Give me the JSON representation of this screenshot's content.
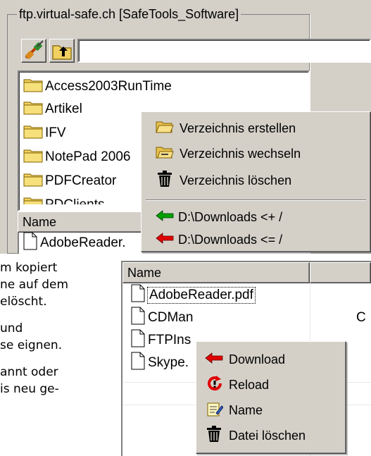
{
  "panel": {
    "title": "ftp.virtual-safe.ch [SafeTools_Software]",
    "path_value": ""
  },
  "toolbar": {
    "connect_icon": "connect-plug-icon",
    "up_icon": "folder-up-icon"
  },
  "folders": [
    {
      "label": "Access2003RunTime"
    },
    {
      "label": "Artikel"
    },
    {
      "label": "IFV"
    },
    {
      "label": "NotePad 2006"
    },
    {
      "label": "PDFCreator"
    },
    {
      "label": "PDClients"
    }
  ],
  "top_list": {
    "header_name": "Name",
    "first_file": "AdobeReader."
  },
  "folder_menu": {
    "items": [
      {
        "label": "Verzeichnis erstellen",
        "icon": "folder-open-icon"
      },
      {
        "label": "Verzeichnis wechseln",
        "icon": "folder-change-icon"
      },
      {
        "label": "Verzeichnis löschen",
        "icon": "trash-icon"
      },
      {
        "label": "D:\\Downloads <+ /",
        "icon": "arrow-left-green-icon"
      },
      {
        "label": "D:\\Downloads <= /",
        "icon": "arrow-left-red-icon"
      }
    ]
  },
  "body_text": {
    "lines": [
      "m kopiert",
      "ne auf dem",
      "elöscht.",
      "und",
      "se eignen.",
      "annt oder",
      "is neu ge-"
    ]
  },
  "file_list": {
    "header_name": "Name",
    "files": [
      {
        "name": "AdobeReader.pdf",
        "extra": ""
      },
      {
        "name": "CDMan",
        "extra": "C"
      },
      {
        "name": "FTPIns",
        "extra": ""
      },
      {
        "name": "Skype.",
        "extra": ""
      }
    ]
  },
  "file_menu": {
    "items": [
      {
        "label": "Download",
        "icon": "arrow-left-red-icon"
      },
      {
        "label": "Reload",
        "icon": "reload-icon"
      },
      {
        "label": "Name",
        "icon": "rename-icon"
      },
      {
        "label": "Datei löschen",
        "icon": "trash-icon"
      }
    ]
  },
  "colors": {
    "window_gray": "#d4d0c8",
    "folder_yellow": "#f0d060",
    "arrow_green": "#00a000",
    "arrow_red": "#e00000"
  }
}
